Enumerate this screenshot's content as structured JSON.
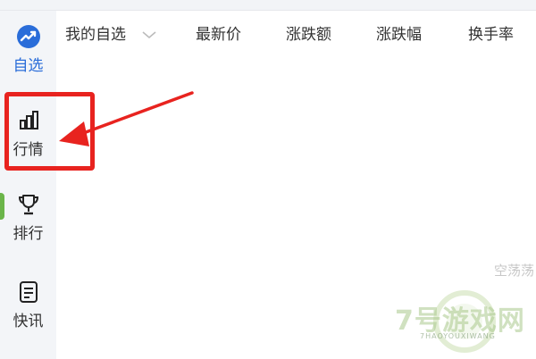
{
  "sidebar": {
    "items": [
      {
        "label": "自选",
        "icon": "trend-icon",
        "active": true
      },
      {
        "label": "行情",
        "icon": "bar-chart-icon",
        "active": false
      },
      {
        "label": "排行",
        "icon": "trophy-icon",
        "active": false
      },
      {
        "label": "快讯",
        "icon": "news-icon",
        "active": false
      }
    ]
  },
  "header": {
    "columns": [
      "我的自选",
      "最新价",
      "涨跌额",
      "涨跌幅",
      "换手率"
    ]
  },
  "main": {
    "empty_text": "空荡荡"
  },
  "watermark": {
    "text": "7号游戏网",
    "subtext": "7HAOYOUXIWANG"
  },
  "colors": {
    "accent": "#2a6dd9",
    "annotation": "#e8231f"
  }
}
